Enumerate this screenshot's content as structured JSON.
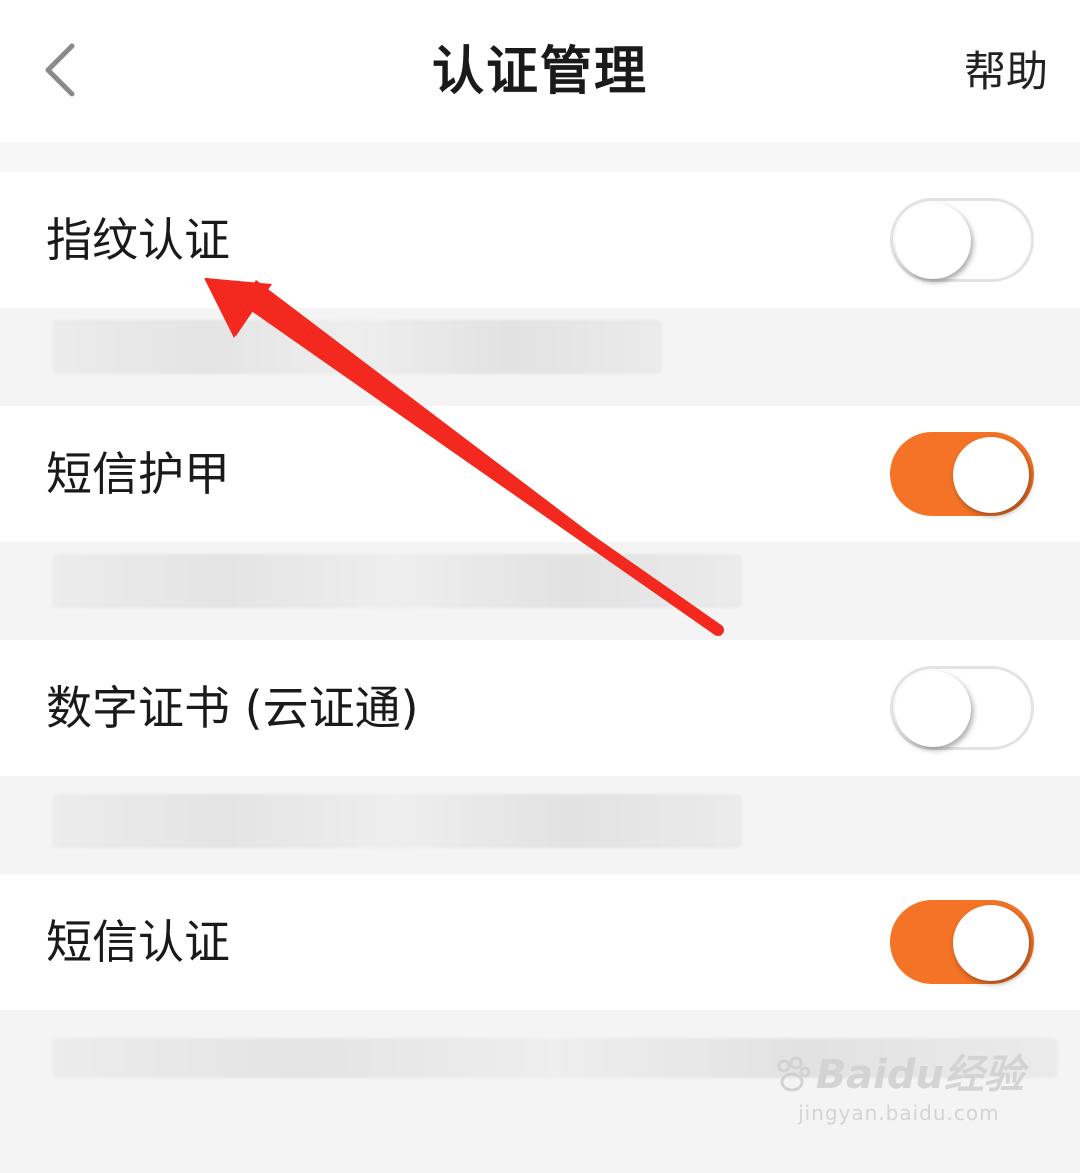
{
  "header": {
    "title": "认证管理",
    "help_label": "帮助",
    "back_icon": "chevron-left-icon"
  },
  "settings": [
    {
      "label": "指纹认证",
      "enabled": false
    },
    {
      "label": "短信护甲",
      "enabled": true
    },
    {
      "label": "数字证书 (云证通)",
      "enabled": false
    },
    {
      "label": "短信认证",
      "enabled": true
    }
  ],
  "colors": {
    "accent": "#f47326",
    "annotation_arrow": "#f3281e",
    "background": "#f6f6f6"
  },
  "watermark": {
    "brand": "Baidu经验",
    "url": "jingyan.baidu.com"
  }
}
